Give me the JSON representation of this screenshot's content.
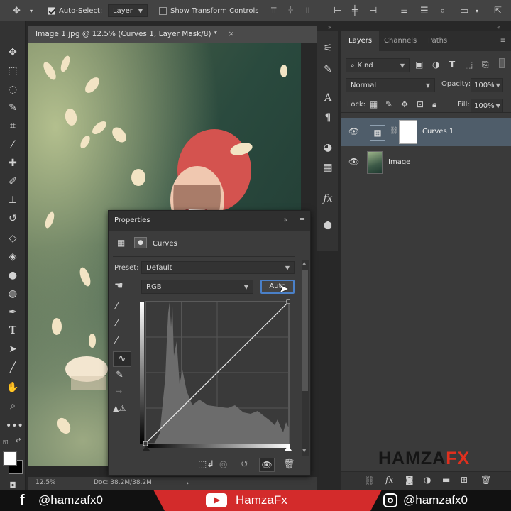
{
  "option_bar": {
    "auto_select_label": "Auto-Select:",
    "auto_select_value": "Layer",
    "show_transform_label": "Show Transform Controls"
  },
  "document": {
    "tab_title": "Image 1.jpg @ 12.5% (Curves 1, Layer Mask/8) *",
    "tab_close": "×",
    "zoom": "12.5%",
    "doc_size": "Doc: 38.2M/38.2M",
    "status_arrow": "›"
  },
  "layers_panel": {
    "tabs": [
      "Layers",
      "Channels",
      "Paths"
    ],
    "filter_kind": "Kind",
    "blend_mode": "Normal",
    "opacity_label": "Opacity:",
    "opacity_value": "100%",
    "lock_label": "Lock:",
    "fill_label": "Fill:",
    "fill_value": "100%",
    "layers": [
      {
        "name": "Curves 1",
        "selected": true
      },
      {
        "name": "Image",
        "selected": false
      }
    ]
  },
  "properties_panel": {
    "title": "Properties",
    "adjustment_name": "Curves",
    "preset_label": "Preset:",
    "preset_value": "Default",
    "channel_value": "RGB",
    "auto_button": "Auto",
    "curve": {
      "x": [
        0,
        255
      ],
      "y": [
        0,
        255
      ]
    }
  },
  "watermark": {
    "part1": "HAMZA",
    "part2": "FX"
  },
  "banner": {
    "facebook": "@hamzafx0",
    "youtube": "HamzaFx",
    "instagram": "@hamzafx0"
  },
  "colors": {
    "accent_blue": "#4f5d6a",
    "auto_button_border": "#4a80c8",
    "banner_red": "#d32b2b",
    "watermark_red": "#e0301e"
  }
}
